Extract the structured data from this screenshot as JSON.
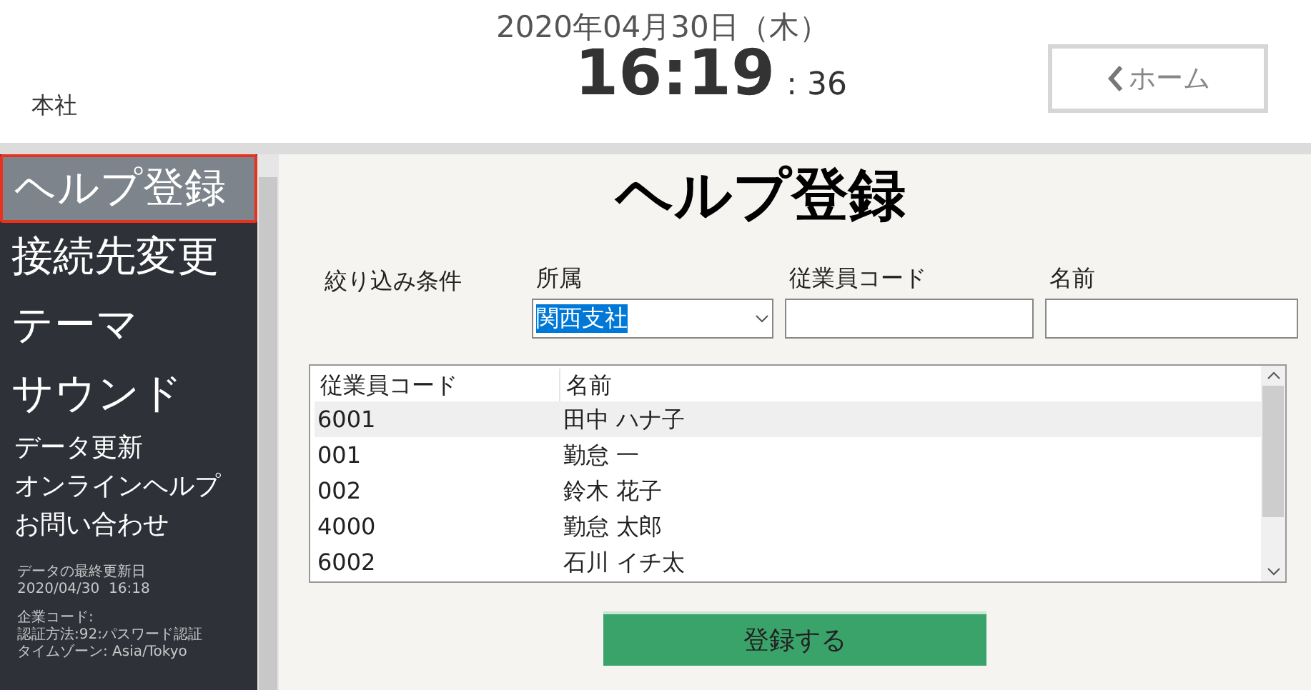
{
  "header": {
    "date": "2020年04月30日（木）",
    "time": "16:19",
    "seconds": ": 36",
    "location": "本社",
    "home_button": "ホーム"
  },
  "sidebar": {
    "items": [
      {
        "label": "ヘルプ登録",
        "kind": "large",
        "selected": true
      },
      {
        "label": "接続先変更",
        "kind": "large",
        "selected": false
      },
      {
        "label": "テーマ",
        "kind": "large",
        "selected": false
      },
      {
        "label": "サウンド",
        "kind": "large",
        "selected": false
      },
      {
        "label": "データ更新",
        "kind": "small",
        "selected": false
      },
      {
        "label": "オンラインヘルプ",
        "kind": "small",
        "selected": false
      },
      {
        "label": "お問い合わせ",
        "kind": "small",
        "selected": false
      }
    ],
    "info": [
      [
        "データの最終更新日",
        "2020/04/30  16:18"
      ],
      [
        "企業コード:",
        "認証方法:92:パスワード認証",
        "タイムゾーン: Asia/Tokyo"
      ]
    ]
  },
  "main": {
    "title": "ヘルプ登録",
    "filter_label": "絞り込み条件",
    "filters": [
      {
        "label": "所属",
        "kind": "select",
        "value": "関西支社"
      },
      {
        "label": "従業員コード",
        "kind": "text"
      },
      {
        "label": "名前",
        "kind": "text"
      }
    ],
    "table": {
      "columns": [
        "従業員コード",
        "名前"
      ],
      "rows": [
        {
          "cells": [
            "6001",
            "田中 ハナ子"
          ],
          "selected": true
        },
        {
          "cells": [
            "001",
            "勤怠 一"
          ],
          "selected": false
        },
        {
          "cells": [
            "002",
            "鈴木 花子"
          ],
          "selected": false
        },
        {
          "cells": [
            "4000",
            "勤怠 太郎"
          ],
          "selected": false
        },
        {
          "cells": [
            "6002",
            "石川 イチ太"
          ],
          "selected": false
        }
      ]
    },
    "submit_button": "登録する"
  }
}
